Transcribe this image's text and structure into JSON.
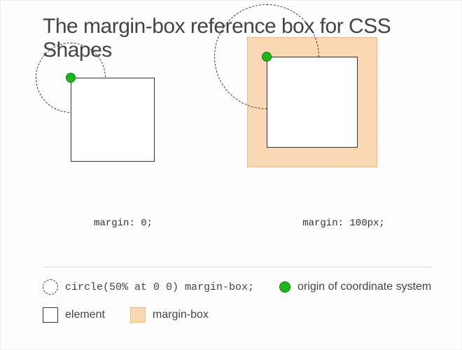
{
  "title": "The margin-box reference box for CSS Shapes",
  "examples": {
    "left": {
      "caption": "margin: 0;"
    },
    "right": {
      "caption": "margin: 100px;"
    }
  },
  "legend": {
    "shape": "circle(50% at 0 0) margin-box;",
    "origin": "origin of coordinate system",
    "element": "element",
    "marginbox": "margin-box"
  },
  "colors": {
    "marginFill": "#fbd8b4",
    "marginBorder": "#e8a45f",
    "originFill": "#1db61d",
    "originBorder": "#0a7a0a"
  }
}
